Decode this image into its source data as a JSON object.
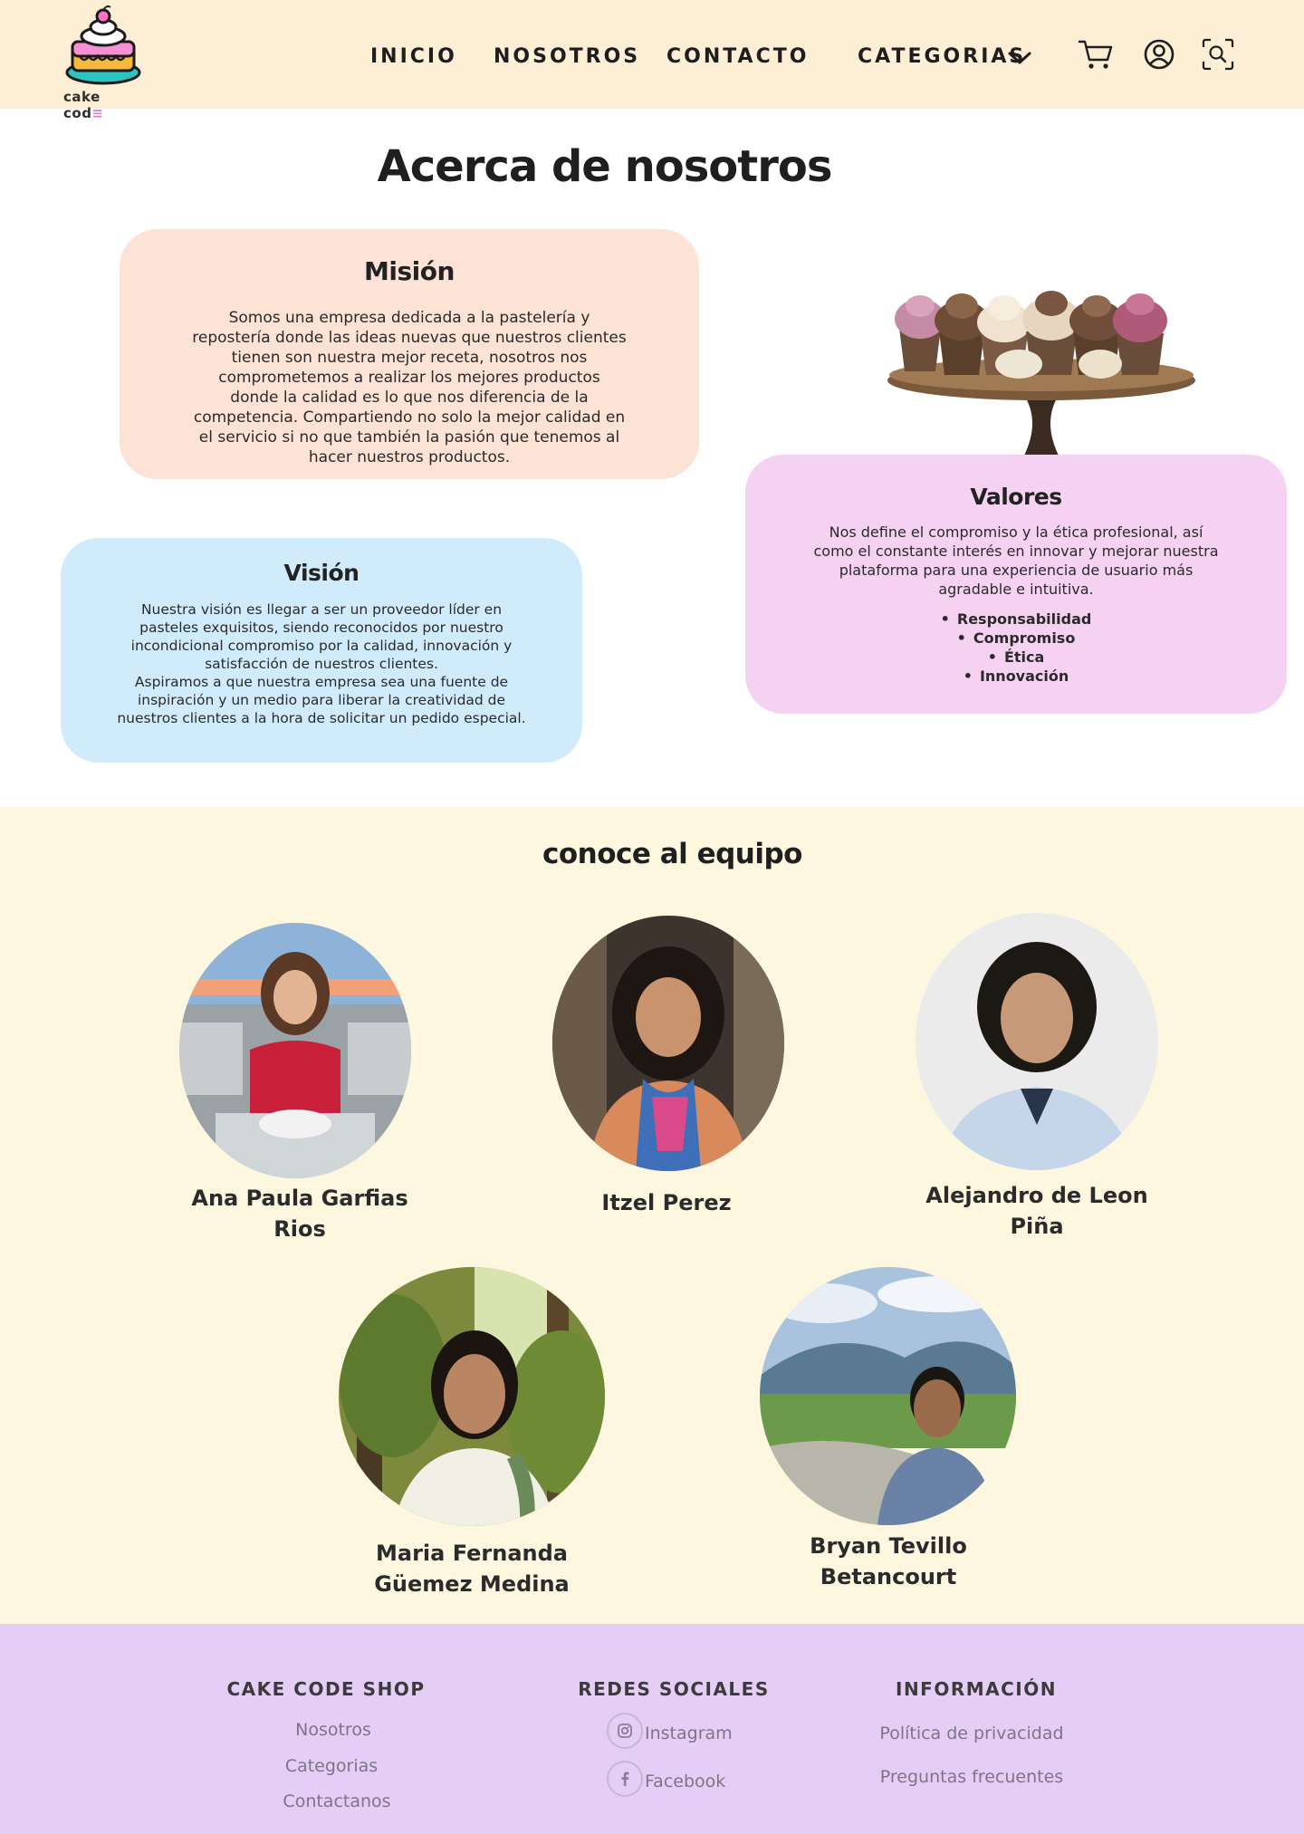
{
  "header": {
    "logo_text": "cake cod",
    "logo_menu_glyph": "≡",
    "nav": [
      {
        "label": "INICIO"
      },
      {
        "label": "NOSOTROS"
      },
      {
        "label": "CONTACTO"
      },
      {
        "label": "CATEGORIAS"
      }
    ],
    "icons": [
      "cart-icon",
      "user-icon",
      "search-icon"
    ]
  },
  "about": {
    "title": "Acerca de  nosotros",
    "mision": {
      "title": "Misión",
      "text": "Somos una empresa dedicada a la pastelería y repostería donde las  ideas nuevas que nuestros clientes tienen son nuestra mejor receta, nosotros nos comprometemos a realizar los mejores productos donde la calidad es lo que nos diferencia de la competencia. Compartiendo no solo la mejor calidad en el servicio si no que también la pasión que tenemos al hacer nuestros productos."
    },
    "vision": {
      "title": "Visión",
      "text": "Nuestra visión es llegar a ser un proveedor líder en pasteles exquisitos, siendo reconocidos por nuestro incondicional compromiso por la calidad, innovación y satisfacción de nuestros clientes.",
      "text2": "Aspiramos a que nuestra empresa sea una fuente de inspiración y un medio para liberar la creatividad de nuestros clientes a la hora de solicitar un pedido especial."
    },
    "valores": {
      "title": "Valores",
      "text": "Nos define el compromiso y la ética profesional, así como el constante interés en innovar y mejorar nuestra plataforma para una experiencia de usuario más agradable e intuitiva.",
      "items": [
        "Responsabilidad",
        "Compromiso",
        "Ética",
        "Innovación"
      ]
    }
  },
  "team": {
    "title": "conoce al equipo",
    "members": [
      {
        "name": "Ana Paula Garfias Rios"
      },
      {
        "name": "Itzel Perez"
      },
      {
        "name": "Alejandro de Leon Piña"
      },
      {
        "name": "Maria Fernanda Güemez Medina"
      },
      {
        "name": "Bryan Tevillo Betancourt"
      }
    ]
  },
  "footer": {
    "shop": {
      "title": "CAKE CODE SHOP",
      "links": [
        "Nosotros",
        "Categorias",
        "Contactanos"
      ]
    },
    "social": {
      "title": "REDES SOCIALES",
      "links": [
        "Instagram",
        "Facebook"
      ]
    },
    "info": {
      "title": "INFORMACIÓN",
      "links": [
        "Política de privacidad",
        "Preguntas frecuentes"
      ]
    }
  },
  "colors": {
    "header_bg": "#fdeed6",
    "mision_bg": "#fde2d6",
    "vision_bg": "#d0ecfc",
    "valores_bg": "#f5d2f2",
    "team_bg": "#fdf7e0",
    "footer_bg": "#e5cef6"
  }
}
